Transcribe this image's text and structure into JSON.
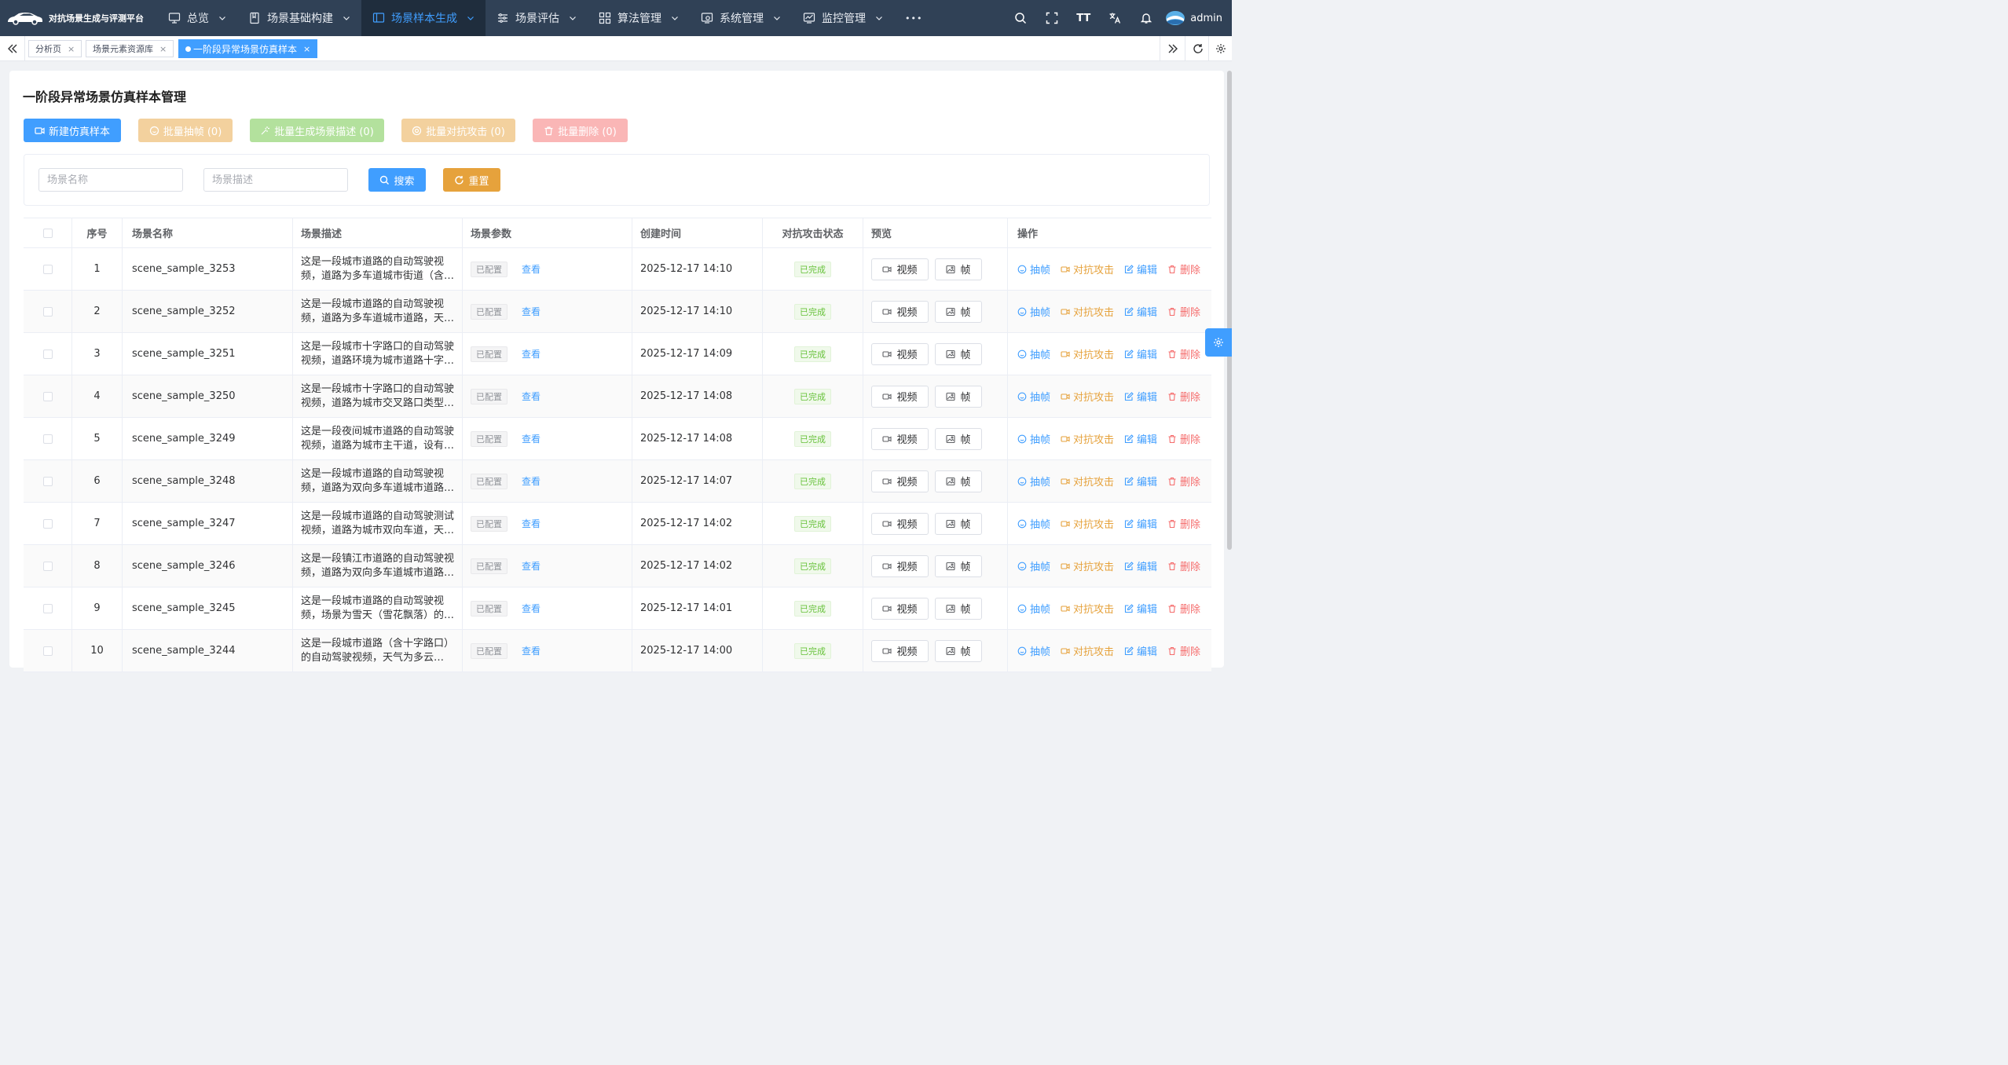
{
  "app": {
    "title": "对抗场景生成与评测平台"
  },
  "nav": {
    "items": [
      {
        "label": "总览",
        "icon": "monitor-icon",
        "active": false
      },
      {
        "label": "场景基础构建",
        "icon": "book-icon",
        "active": false
      },
      {
        "label": "场景样本生成",
        "icon": "screen-icon",
        "active": true
      },
      {
        "label": "场景评估",
        "icon": "sliders-icon",
        "active": false
      },
      {
        "label": "算法管理",
        "icon": "grid-icon",
        "active": false
      },
      {
        "label": "系统管理",
        "icon": "settings-screen-icon",
        "active": false
      },
      {
        "label": "监控管理",
        "icon": "chart-monitor-icon",
        "active": false
      }
    ],
    "more": "•••"
  },
  "header_tools": {
    "font_size_glyph": "TT",
    "user_name": "admin"
  },
  "tags": [
    {
      "label": "分析页",
      "close": "×"
    },
    {
      "label": "场景元素资源库",
      "close": "×"
    },
    {
      "label": "一阶段异常场景仿真样本",
      "close": "×",
      "active": true
    }
  ],
  "page": {
    "title": "一阶段异常场景仿真样本管理",
    "buttons": {
      "create": "新建仿真样本",
      "batch_extract": "批量抽帧 (0)",
      "batch_describe": "批量生成场景描述 (0)",
      "batch_attack": "批量对抗攻击 (0)",
      "batch_delete": "批量删除 (0)"
    }
  },
  "search": {
    "name_placeholder": "场景名称",
    "desc_placeholder": "场景描述",
    "search_label": "搜索",
    "reset_label": "重置"
  },
  "table": {
    "headers": {
      "index": "序号",
      "name": "场景名称",
      "desc": "场景描述",
      "params": "场景参数",
      "time": "创建时间",
      "status": "对抗攻击状态",
      "preview": "预览",
      "ops": "操作"
    },
    "param_tag": "已配置",
    "param_link": "查看",
    "status_tag": "已完成",
    "preview_video": "视频",
    "preview_frame": "帧",
    "op_extract": "抽帧",
    "op_attack": "对抗攻击",
    "op_edit": "编辑",
    "op_delete": "删除",
    "rows": [
      {
        "index": "1",
        "name": "scene_sample_3253",
        "desc": "这是一段城市道路的自动驾驶视频，道路为多车道城市街道（含…",
        "time": "2025-12-17 14:10"
      },
      {
        "index": "2",
        "name": "scene_sample_3252",
        "desc": "这是一段城市道路的自动驾驶视频，道路为多车道城市道路，天…",
        "time": "2025-12-17 14:10"
      },
      {
        "index": "3",
        "name": "scene_sample_3251",
        "desc": "这是一段城市十字路口的自动驾驶视频，道路环境为城市道路十字…",
        "time": "2025-12-17 14:09"
      },
      {
        "index": "4",
        "name": "scene_sample_3250",
        "desc": "这是一段城市十字路口的自动驾驶视频，道路为城市交叉路口类型…",
        "time": "2025-12-17 14:08"
      },
      {
        "index": "5",
        "name": "scene_sample_3249",
        "desc": "这是一段夜间城市道路的自动驾驶视频，道路为城市主干道，设有…",
        "time": "2025-12-17 14:08"
      },
      {
        "index": "6",
        "name": "scene_sample_3248",
        "desc": "这是一段城市道路的自动驾驶视频，道路为双向多车道城市道路…",
        "time": "2025-12-17 14:07"
      },
      {
        "index": "7",
        "name": "scene_sample_3247",
        "desc": "这是一段城市道路的自动驾驶测试视频，道路为城市双向车道，天…",
        "time": "2025-12-17 14:02"
      },
      {
        "index": "8",
        "name": "scene_sample_3246",
        "desc": "这是一段镇江市道路的自动驾驶视频，道路为双向多车道城市道路…",
        "time": "2025-12-17 14:02"
      },
      {
        "index": "9",
        "name": "scene_sample_3245",
        "desc": "这是一段城市道路的自动驾驶视频，场景为雪天（雪花飘落）的…",
        "time": "2025-12-17 14:01"
      },
      {
        "index": "10",
        "name": "scene_sample_3244",
        "desc": "这是一段城市道路（含十字路口）的自动驾驶视频，天气为多云…",
        "time": "2025-12-17 14:00"
      }
    ]
  },
  "colors": {
    "nav_bg": "#304156",
    "nav_active_bg": "#1f2d3d",
    "primary": "#409eff",
    "warning": "#e6a23c",
    "danger": "#f56c6c",
    "success": "#67c23a"
  }
}
